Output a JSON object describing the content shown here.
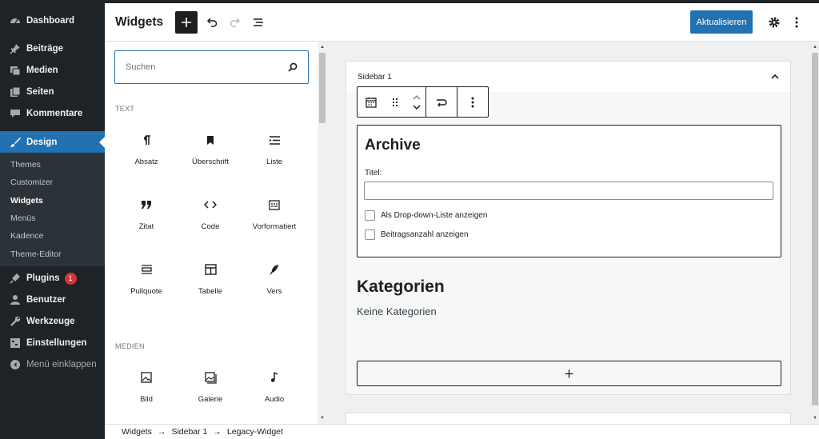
{
  "admin_menu": {
    "items_top": [
      {
        "label": "Dashboard",
        "icon": "dashboard-icon"
      },
      {
        "label": "Beiträge",
        "icon": "pin-icon"
      },
      {
        "label": "Medien",
        "icon": "media-icon"
      },
      {
        "label": "Seiten",
        "icon": "pages-icon"
      },
      {
        "label": "Kommentare",
        "icon": "comment-icon"
      }
    ],
    "design": {
      "label": "Design",
      "icon": "brush-icon"
    },
    "submenu": [
      "Themes",
      "Customizer",
      "Widgets",
      "Menüs",
      "Kadence",
      "Theme-Editor"
    ],
    "current_sub": "Widgets",
    "items_bottom": [
      {
        "label": "Plugins",
        "icon": "plugin-icon",
        "badge": "1"
      },
      {
        "label": "Benutzer",
        "icon": "user-icon"
      },
      {
        "label": "Werkzeuge",
        "icon": "wrench-icon"
      },
      {
        "label": "Einstellungen",
        "icon": "settings-icon"
      }
    ],
    "collapse": "Menü einklappen"
  },
  "header": {
    "title": "Widgets",
    "update_label": "Aktualisieren"
  },
  "inserter": {
    "search_placeholder": "Suchen",
    "categories": [
      {
        "title": "TEXT",
        "blocks": [
          {
            "label": "Absatz",
            "icon": "paragraph-icon"
          },
          {
            "label": "Überschrift",
            "icon": "heading-icon"
          },
          {
            "label": "Liste",
            "icon": "list-icon"
          },
          {
            "label": "Zitat",
            "icon": "quote-icon"
          },
          {
            "label": "Code",
            "icon": "code-icon"
          },
          {
            "label": "Vorformatiert",
            "icon": "preformatted-icon"
          },
          {
            "label": "Pullquote",
            "icon": "pullquote-icon"
          },
          {
            "label": "Tabelle",
            "icon": "table-icon"
          },
          {
            "label": "Vers",
            "icon": "verse-icon"
          }
        ]
      },
      {
        "title": "MEDIEN",
        "blocks": [
          {
            "label": "Bild",
            "icon": "image-icon"
          },
          {
            "label": "Galerie",
            "icon": "gallery-icon"
          },
          {
            "label": "Audio",
            "icon": "audio-icon"
          }
        ]
      }
    ]
  },
  "canvas": {
    "area_title": "Sidebar 1",
    "archive": {
      "title": "Archive",
      "field_label": "Titel:",
      "field_value": "",
      "option1": "Als Drop-down-Liste anzeigen",
      "option2": "Beitragsanzahl anzeigen"
    },
    "categories": {
      "title": "Kategorien",
      "empty": "Keine Kategorien"
    }
  },
  "breadcrumbs": [
    "Widgets",
    "Sidebar 1",
    "Legacy-Widget"
  ],
  "colors": {
    "accent": "#2271b1",
    "admin_bg": "#1d2327",
    "badge": "#d63638"
  }
}
